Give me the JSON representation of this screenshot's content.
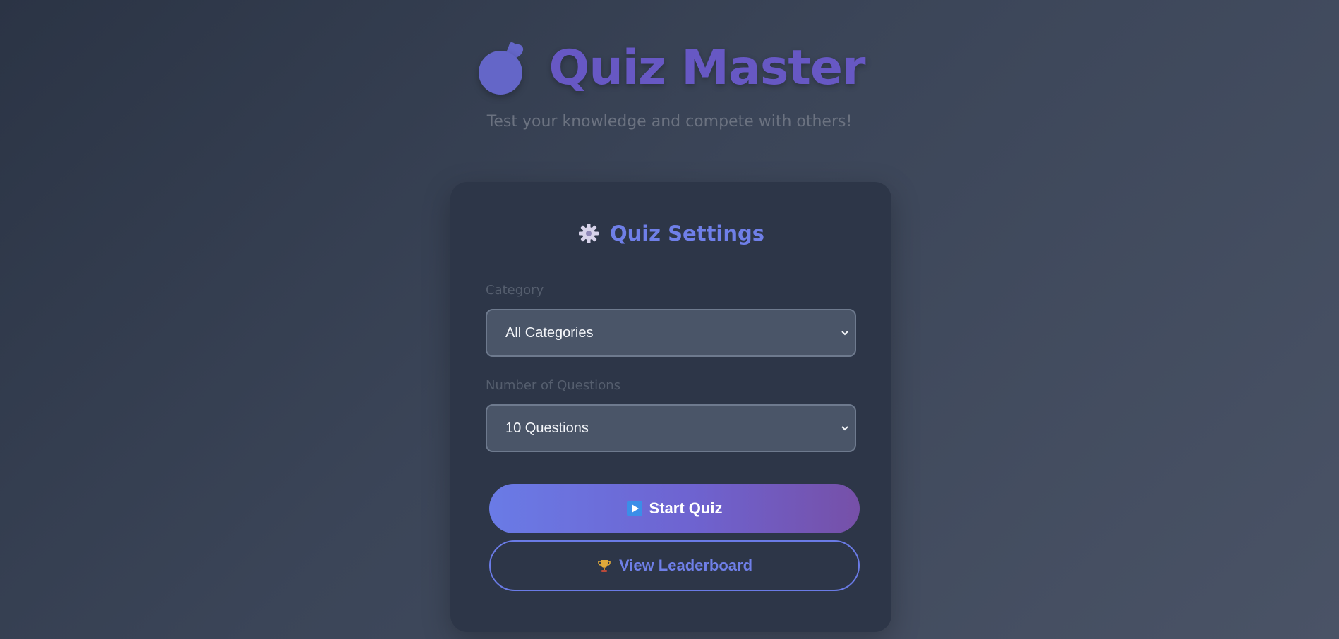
{
  "header": {
    "app_icon": "apple-icon",
    "title": "Quiz Master",
    "subtitle": "Test your knowledge and compete with others!"
  },
  "settings": {
    "icon": "gear-icon",
    "title": "Quiz Settings",
    "category": {
      "label": "Category",
      "selected": "All Categories"
    },
    "questions": {
      "label": "Number of Questions",
      "selected": "10 Questions"
    }
  },
  "actions": {
    "start_icon": "play-icon",
    "start_label": "Start Quiz",
    "leaderboard_icon": "trophy-icon",
    "leaderboard_label": "View Leaderboard"
  },
  "colors": {
    "accent": "#6f7fe8",
    "title": "#6758c4",
    "card": "#2d3648",
    "select_bg": "#4a5568"
  }
}
